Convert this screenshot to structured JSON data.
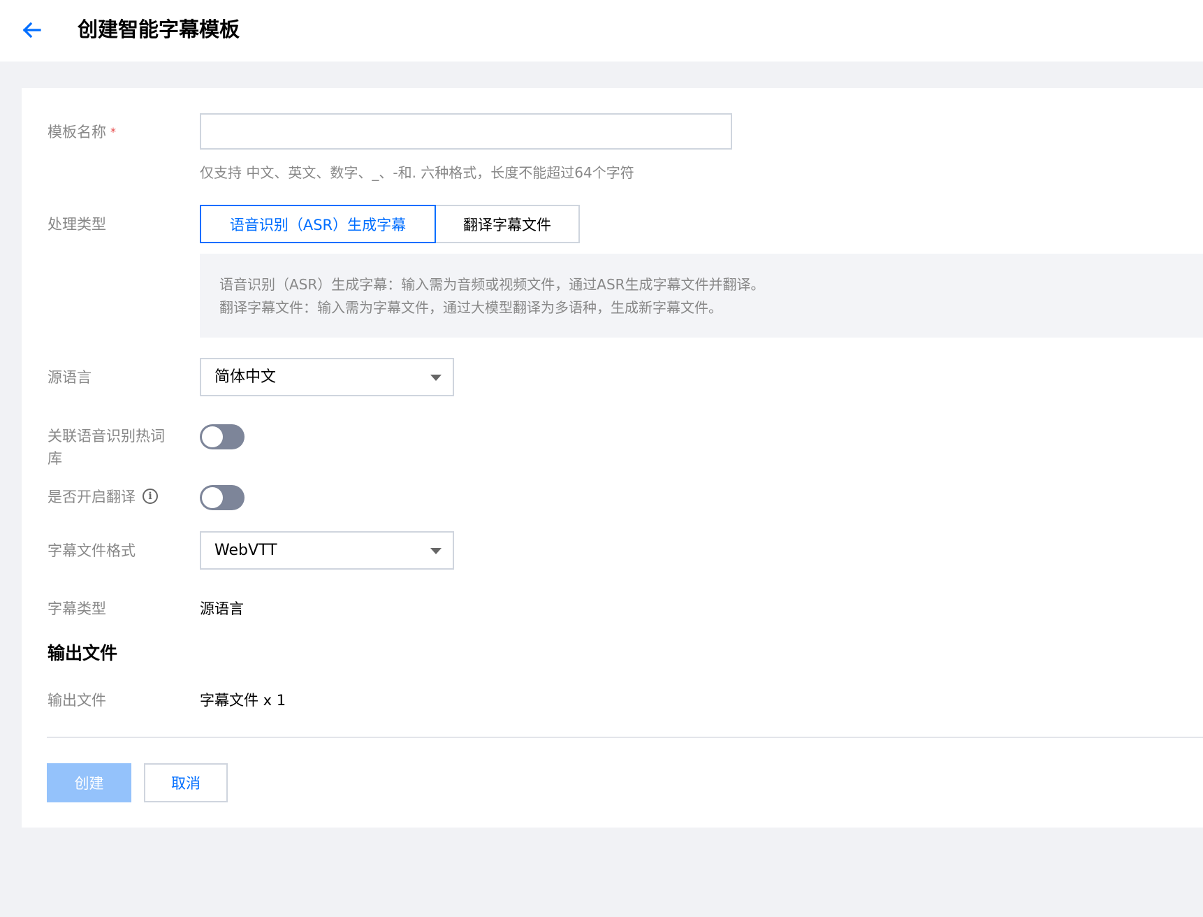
{
  "header": {
    "title": "创建智能字幕模板",
    "back_icon": "arrow-left-icon",
    "accent": "#006eff"
  },
  "form": {
    "template_name": {
      "label": "模板名称",
      "required_mark": "*",
      "value": "",
      "hint": "仅支持 中文、英文、数字、_、-和. 六种格式，长度不能超过64个字符"
    },
    "process_type": {
      "label": "处理类型",
      "options": [
        "语音识别（ASR）生成字幕",
        "翻译字幕文件"
      ],
      "selected": "语音识别（ASR）生成字幕",
      "description": [
        "语音识别（ASR）生成字幕：输入需为音频或视频文件，通过ASR生成字幕文件并翻译。",
        "翻译字幕文件：输入需为字幕文件，通过大模型翻译为多语种，生成新字幕文件。"
      ]
    },
    "source_language": {
      "label": "源语言",
      "value": "简体中文"
    },
    "hotword": {
      "label_line1": "关联语音识别热词",
      "label_line2": "库",
      "enabled": false
    },
    "translation": {
      "label": "是否开启翻译",
      "info_icon": "info-icon",
      "info_glyph": "i",
      "enabled": false
    },
    "subtitle_format": {
      "label": "字幕文件格式",
      "value": "WebVTT"
    },
    "subtitle_type": {
      "label": "字幕类型",
      "value": "源语言"
    }
  },
  "output": {
    "section_title": "输出文件",
    "label": "输出文件",
    "value": "字幕文件 x 1"
  },
  "actions": {
    "create_label": "创建",
    "cancel_label": "取消"
  }
}
